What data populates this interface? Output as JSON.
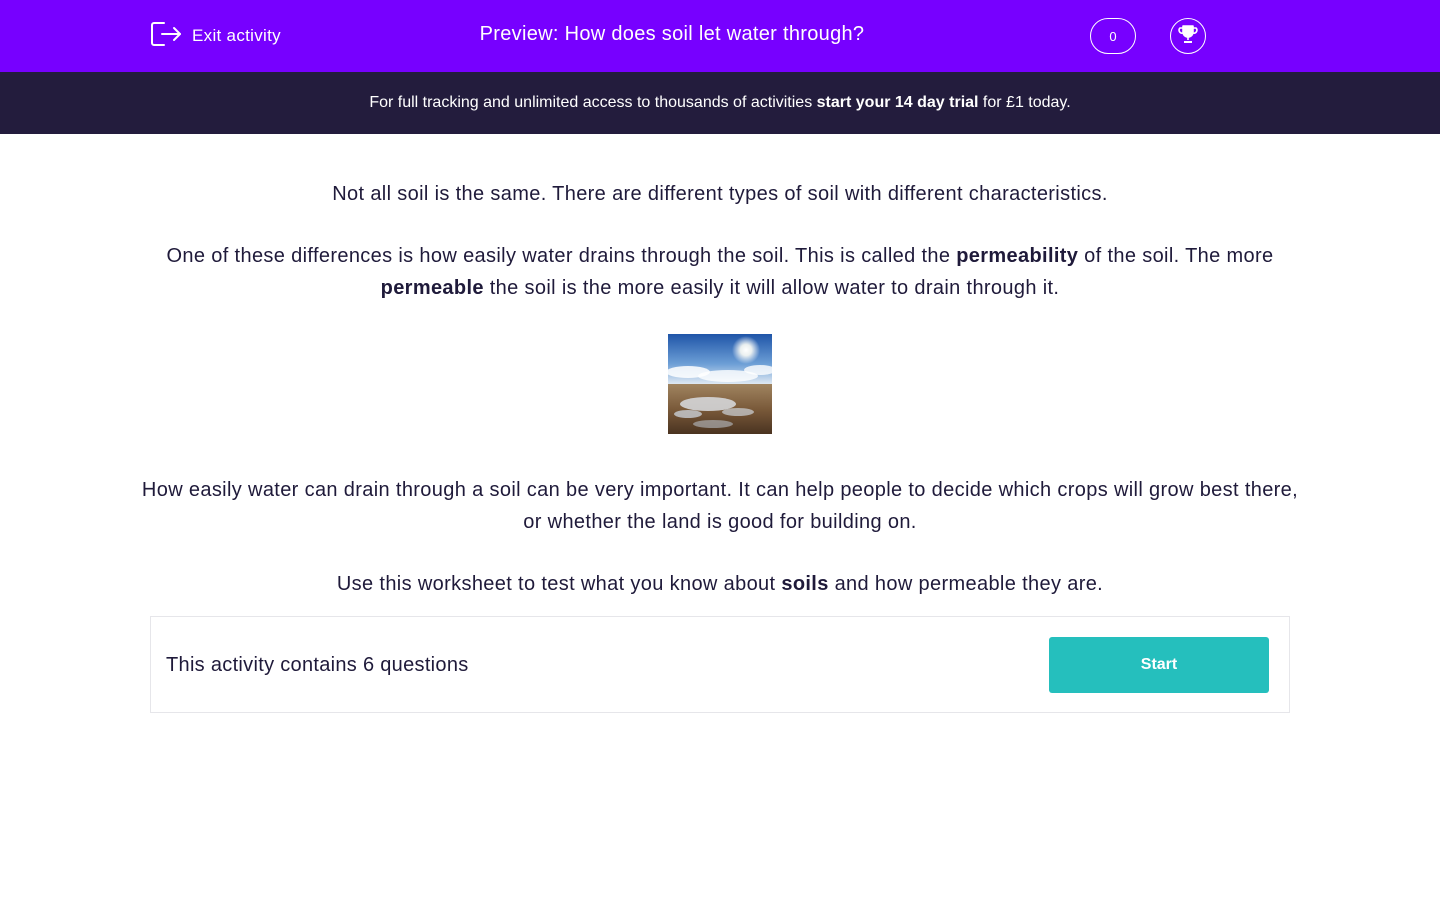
{
  "header": {
    "exit_label": "Exit activity",
    "title": "Preview: How does soil let water through?",
    "score": "0",
    "icons": {
      "exit": "exit-icon",
      "trophy": "trophy-icon"
    },
    "bg_color": "#7700ff"
  },
  "banner": {
    "text_before": "For full tracking and unlimited access to thousands of activities ",
    "trial_link": "start your 14 day trial",
    "text_after": " for £1 today.",
    "bg_color": "#231c3d"
  },
  "intro": {
    "p1": "Not all soil is the same. There are different types of soil with different characteristics.",
    "p2_a": "One of these differences is how easily water drains through the soil.  This is called the ",
    "p2_b": "permeability",
    "p2_c": " of the soil.  The more ",
    "p2_d": "permeable",
    "p2_e": " the soil is the more easily it will allow water to drain through it.",
    "image_name": "waterlogged-soil-image",
    "p3": "How easily water can drain through a soil can be very important. It can help people to decide which crops will grow best there, or whether the land is good for building on.",
    "p4_a": "Use this worksheet to test what you know about ",
    "p4_b": "soils",
    "p4_c": " and how permeable they are."
  },
  "activity": {
    "questions_text": "This activity contains 6 questions",
    "start_label": "Start",
    "start_color": "#25bfbd"
  }
}
